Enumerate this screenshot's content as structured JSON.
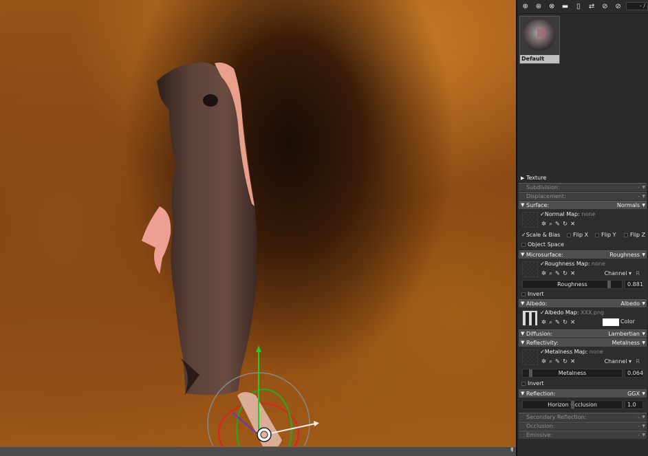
{
  "toolbar": {
    "icons": [
      "add-icon",
      "duplicate-icon",
      "merge-icon",
      "folder-icon",
      "trash-icon",
      "select-icon",
      "sampler-icon",
      "reset-icon"
    ],
    "glyphs": [
      "⊕",
      "⊛",
      "⊗",
      "▬",
      "🗑",
      "⇄",
      "⊘",
      "⊘"
    ],
    "counter": "- /"
  },
  "library": {
    "materials": [
      {
        "name": "Default"
      }
    ]
  },
  "properties": {
    "texture": "Texture",
    "subdivision": {
      "label": "Subdivision:",
      "value": "-"
    },
    "displacement": {
      "label": "Displacement:",
      "value": "-"
    },
    "surface": {
      "label": "Surface:",
      "value": "Normals",
      "map_label": "Normal Map:",
      "map_value": "none",
      "scale_bias": "Scale & Bias",
      "flip_x": "Flip X",
      "flip_y": "Flip Y",
      "flip_z": "Flip Z",
      "object_space": "Object Space"
    },
    "microsurface": {
      "label": "Microsurface:",
      "value": "Roughness",
      "map_label": "Roughness Map:",
      "map_value": "none",
      "channel": "Channel",
      "channel_value": "R",
      "slider_label": "Roughness",
      "slider_value": "0.881",
      "slider_fraction": 0.881,
      "invert": "Invert"
    },
    "albedo": {
      "label": "Albedo:",
      "value": "Albedo",
      "map_label": "Albedo Map:",
      "map_value": "XXX.png",
      "color_label": "Color",
      "color": "#ffffff"
    },
    "diffusion": {
      "label": "Diffusion:",
      "value": "Lambertian"
    },
    "reflectivity": {
      "label": "Reflectivity:",
      "value": "Metalness",
      "map_label": "Metalness Map:",
      "map_value": "none",
      "channel": "Channel",
      "channel_value": "R",
      "slider_label": "Metalness",
      "slider_value": "0.064",
      "slider_fraction": 0.064,
      "invert": "Invert"
    },
    "reflection": {
      "label": "Reflection:",
      "value": "GGX",
      "slider_label": "Horizon Occlusion",
      "slider_value": "1.0",
      "slider_fraction": 0.5
    },
    "secondary_reflection": {
      "label": "Secondary Reflection:",
      "value": "-"
    },
    "occlusion": {
      "label": "Occlusion:",
      "value": "-"
    },
    "emissive": {
      "label": "Emissive:",
      "value": "-"
    }
  },
  "colors": {
    "background_accent": "#a15a18",
    "dress": "#5a3f36",
    "ribbon": "#e9a08a"
  }
}
